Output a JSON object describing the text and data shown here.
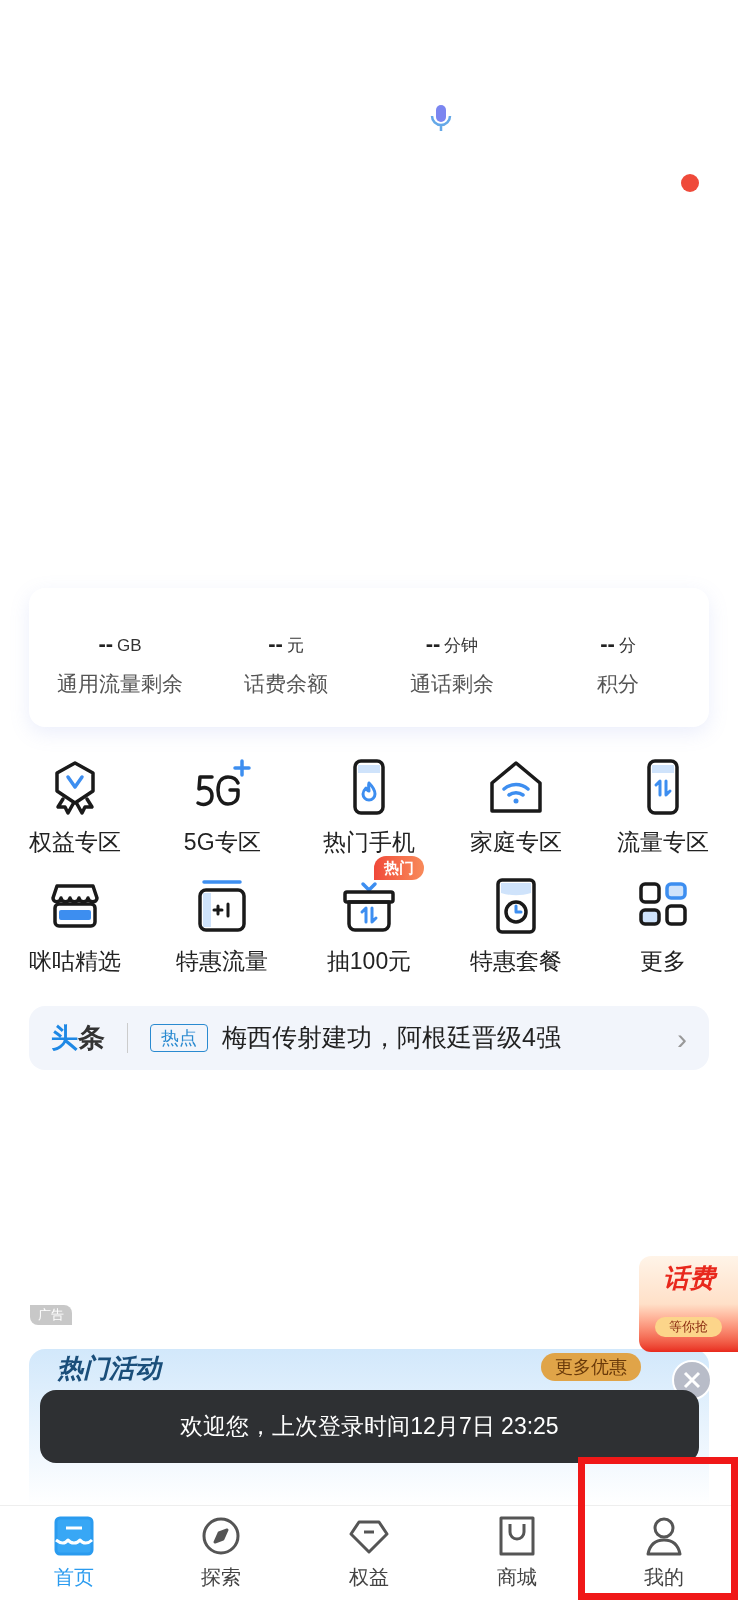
{
  "stats": [
    {
      "value": "--",
      "unit": "GB",
      "label": "通用流量剩余"
    },
    {
      "value": "--",
      "unit": "元",
      "label": "话费余额"
    },
    {
      "value": "--",
      "unit": "分钟",
      "label": "通话剩余"
    },
    {
      "value": "--",
      "unit": "分",
      "label": "积分"
    }
  ],
  "services": [
    {
      "label": "权益专区"
    },
    {
      "label": "5G专区"
    },
    {
      "label": "热门手机"
    },
    {
      "label": "家庭专区"
    },
    {
      "label": "流量专区"
    },
    {
      "label": "咪咕精选"
    },
    {
      "label": "特惠流量"
    },
    {
      "label": "抽100元",
      "badge": "热门"
    },
    {
      "label": "特惠套餐"
    },
    {
      "label": "更多"
    }
  ],
  "headline": {
    "title_1": "头",
    "title_2": "条",
    "tag": "热点",
    "text": "梅西传射建功，阿根廷晋级4强",
    "arrow": "›"
  },
  "ad": {
    "tag": "广告",
    "title": "热门活动",
    "button": "更多优惠"
  },
  "float_ad": {
    "title": "话费",
    "button": "等你抢"
  },
  "toast": "欢迎您，上次登录时间12月7日 23:25",
  "tabs": [
    {
      "label": "首页",
      "selected": true,
      "highlighted": false
    },
    {
      "label": "探索",
      "selected": false,
      "highlighted": false
    },
    {
      "label": "权益",
      "selected": false,
      "highlighted": false
    },
    {
      "label": "商城",
      "selected": false,
      "highlighted": false
    },
    {
      "label": "我的",
      "selected": false,
      "highlighted": true
    }
  ]
}
